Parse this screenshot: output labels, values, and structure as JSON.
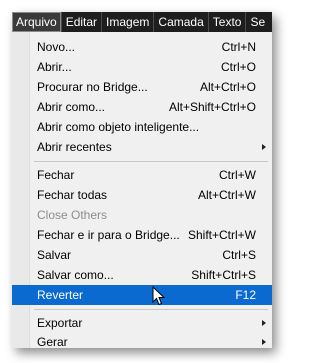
{
  "menubar": {
    "items": [
      {
        "label": "Arquivo",
        "active": true
      },
      {
        "label": "Editar",
        "active": false
      },
      {
        "label": "Imagem",
        "active": false
      },
      {
        "label": "Camada",
        "active": false
      },
      {
        "label": "Texto",
        "active": false
      },
      {
        "label": "Se",
        "active": false
      }
    ]
  },
  "menu": {
    "items": [
      {
        "label": "Novo...",
        "shortcut": "Ctrl+N"
      },
      {
        "label": "Abrir...",
        "shortcut": "Ctrl+O"
      },
      {
        "label": "Procurar no Bridge...",
        "shortcut": "Alt+Ctrl+O"
      },
      {
        "label": "Abrir como...",
        "shortcut": "Alt+Shift+Ctrl+O"
      },
      {
        "label": "Abrir como objeto inteligente...",
        "shortcut": ""
      },
      {
        "label": "Abrir recentes",
        "shortcut": "",
        "submenu": true
      },
      {
        "label": "Fechar",
        "shortcut": "Ctrl+W"
      },
      {
        "label": "Fechar todas",
        "shortcut": "Alt+Ctrl+W"
      },
      {
        "label": "Close Others",
        "shortcut": "",
        "disabled": true
      },
      {
        "label": "Fechar e ir para o Bridge...",
        "shortcut": "Shift+Ctrl+W"
      },
      {
        "label": "Salvar",
        "shortcut": "Ctrl+S"
      },
      {
        "label": "Salvar como...",
        "shortcut": "Shift+Ctrl+S"
      },
      {
        "label": "Reverter",
        "shortcut": "F12",
        "highlighted": true
      },
      {
        "label": "Exportar",
        "shortcut": "",
        "submenu": true
      },
      {
        "label": "Gerar",
        "shortcut": "",
        "submenu": true
      }
    ]
  },
  "colors": {
    "menubar_bg": "#1e1e1e",
    "menu_bg": "#f0f0f0",
    "highlight": "#0a6ad0",
    "disabled_text": "#8d8d8d"
  },
  "icons": {
    "submenu": "chevron-right-icon",
    "cursor": "mouse-pointer-icon"
  }
}
